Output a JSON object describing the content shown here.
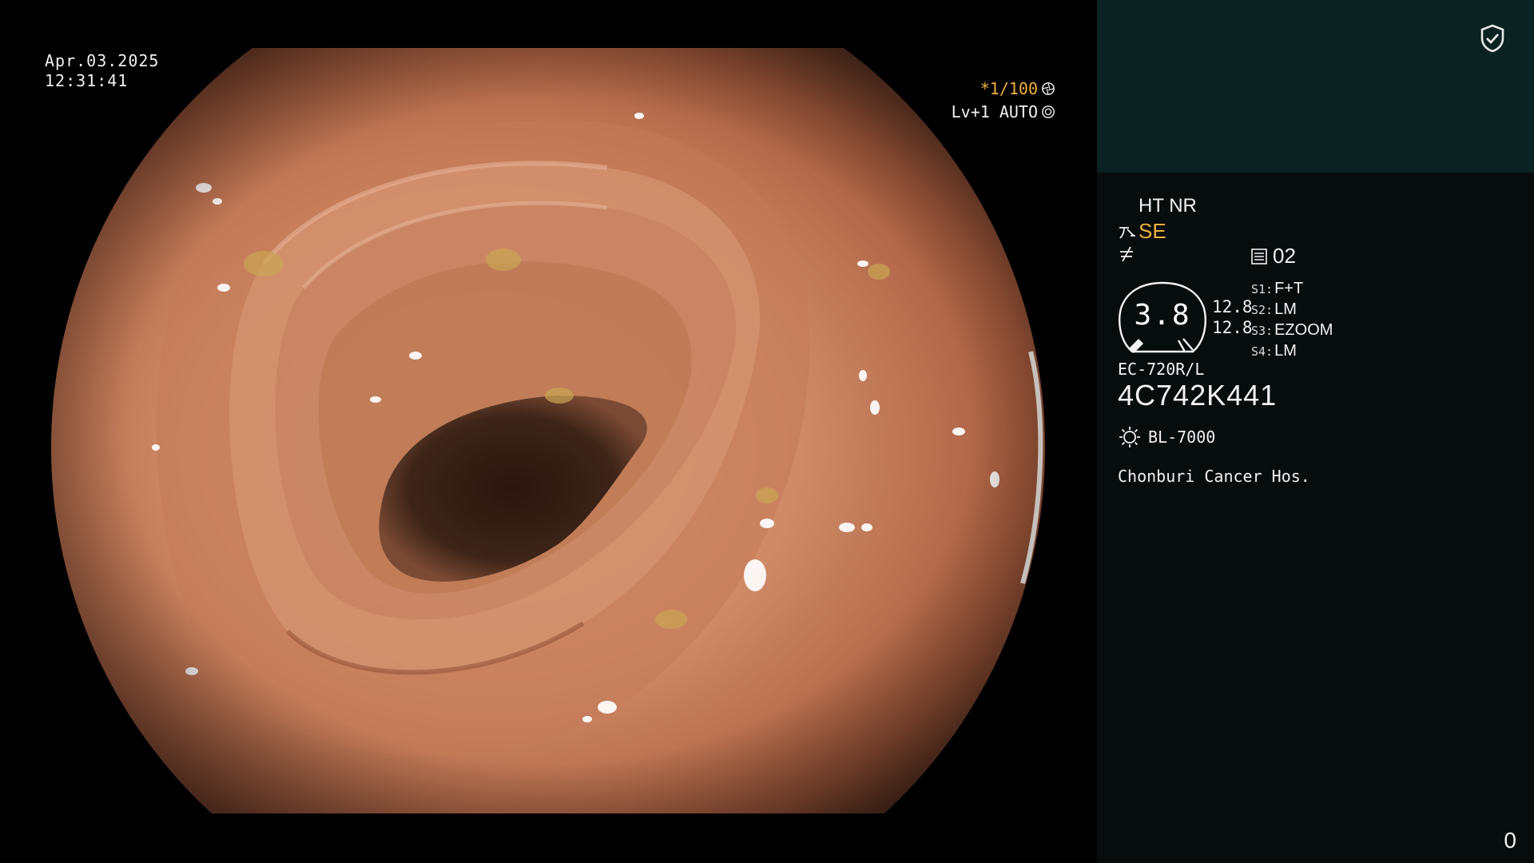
{
  "overlay": {
    "date": "Apr.03.2025",
    "time": "12:31:41",
    "shutter": "*1/100",
    "shutter_icon": "aperture-icon",
    "level": "Lv+1 AUTO",
    "level_icon": "iris-icon"
  },
  "panel": {
    "security_icon": "shield-check-icon",
    "ht_nr": "HT NR",
    "enhancement": "SE",
    "memory": "02",
    "zoom_gauge_value": "3.8",
    "zoom_value_a": "12.8",
    "zoom_value_b": "12.8",
    "switches": [
      {
        "key": "S1:",
        "value": "F+T"
      },
      {
        "key": "S2:",
        "value": "LM"
      },
      {
        "key": "S3:",
        "value": "EZOOM"
      },
      {
        "key": "S4:",
        "value": "LM"
      }
    ],
    "scope_model": "EC-720R/L",
    "scope_serial": "4C742K441",
    "light_source": "BL-7000",
    "hospital": "Chonburi Cancer Hos.",
    "counter": "0"
  },
  "colors": {
    "accent_orange": "#f0b03c",
    "panel_header": "#0b2223",
    "panel_body": "#070c0c"
  }
}
